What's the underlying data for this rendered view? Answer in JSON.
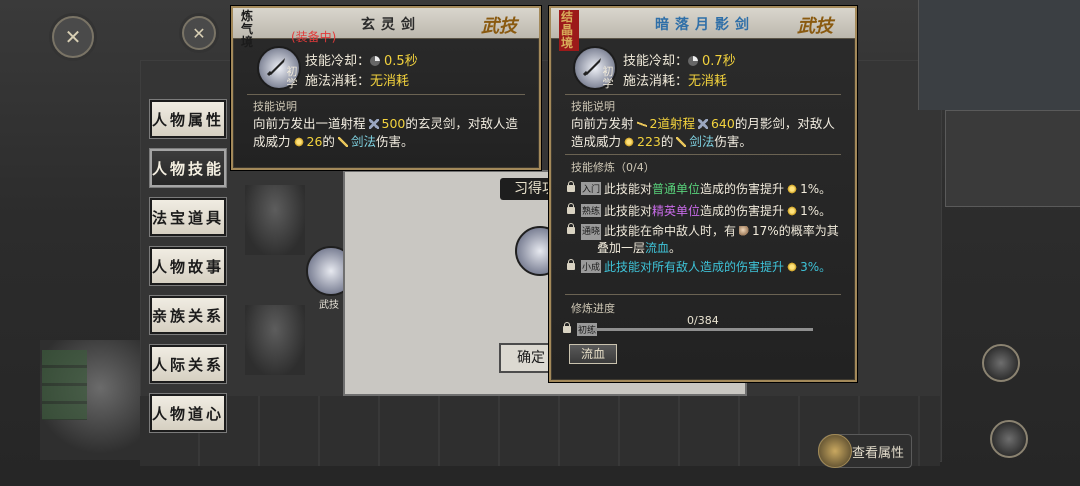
{
  "side_tabs": [
    "人物属性",
    "人物技能",
    "法宝道具",
    "人物故事",
    "亲族关系",
    "人际关系",
    "人物道心"
  ],
  "active_tab_index": 1,
  "dialog": {
    "title": "习得功",
    "confirm_label": "确定"
  },
  "left_skill": {
    "label": "武技"
  },
  "card_left": {
    "realm": "炼气境",
    "title": "玄灵剑",
    "equipped": "(装备中)",
    "type_mark": "武技",
    "level": "初学",
    "cooldown_label": "技能冷却：",
    "cooldown_value": "0.5秒",
    "cost_label": "施法消耗：",
    "cost_value": "无消耗",
    "desc_label": "技能说明",
    "desc": {
      "line1_pre": "向前方发出一道射程",
      "range": "500",
      "line1_post": "的玄灵剑，对敌人造",
      "line2_pre": "成威力",
      "power": "26",
      "line2_mid": "的",
      "style": "剑法",
      "line2_post": "伤害。"
    }
  },
  "card_right": {
    "realm": "结晶境",
    "title": "暗落月影剑",
    "type_mark": "武技",
    "level": "初学",
    "cooldown_label": "技能冷却：",
    "cooldown_value": "0.7秒",
    "cost_label": "施法消耗：",
    "cost_value": "无消耗",
    "desc_label": "技能说明",
    "desc": {
      "line1_pre": "向前方发射",
      "count": "2道射程",
      "range": "640",
      "line1_post": "的月影剑，对敌人",
      "line2_pre": "造成威力",
      "power": "223",
      "line2_mid": "的",
      "style": "剑法",
      "line2_post": "伤害。"
    },
    "cultivation_label": "技能修炼（0/4）",
    "cultivation": [
      {
        "tier": "入门",
        "pre": "此技能对",
        "target": "普通单位",
        "post": "造成的伤害提升",
        "value": "1%。"
      },
      {
        "tier": "熟练",
        "pre": "此技能对",
        "target": "精英单位",
        "post": "造成的伤害提升",
        "value": "1%。"
      },
      {
        "tier": "通晓",
        "pre": "此技能在命中敌人时，有",
        "value": "17%的概率为其",
        "line2_pre": "叠加一层",
        "target": "流血",
        "line2_post": "。"
      },
      {
        "tier": "小成",
        "pre": "此技能对",
        "target": "所有敌人",
        "post": "造成的伤害提升",
        "value": "3%。"
      }
    ],
    "progress_label": "修炼进度",
    "progress_tier": "初练",
    "progress_text": "0/384",
    "progress_fraction": 0,
    "cultivate_button": "流血"
  },
  "view_attributes": "查看属性"
}
